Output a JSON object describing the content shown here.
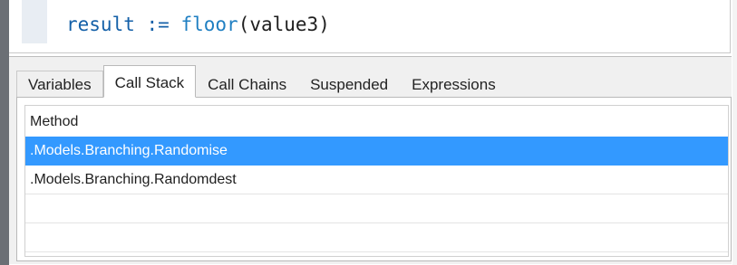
{
  "editor": {
    "code_tokens": {
      "variable": "result",
      "operator": ":=",
      "function": "floor",
      "args": "(value3)"
    }
  },
  "debug_panel": {
    "tabs": [
      {
        "label": "Variables",
        "active": false
      },
      {
        "label": "Call Stack",
        "active": true
      },
      {
        "label": "Call Chains",
        "active": false
      },
      {
        "label": "Suspended",
        "active": false
      },
      {
        "label": "Expressions",
        "active": false
      }
    ],
    "call_stack": {
      "column_header": "Method",
      "rows": [
        {
          "method": ".Models.Branching.Randomise",
          "selected": true
        },
        {
          "method": ".Models.Branching.Randomdest",
          "selected": false
        },
        {
          "method": "",
          "selected": false
        },
        {
          "method": "",
          "selected": false
        }
      ]
    }
  },
  "colors": {
    "selection": "#3399ff",
    "panel_bg": "#f0f0f0",
    "left_bar": "#6b6f75",
    "code_keyword": "#1460a8"
  }
}
